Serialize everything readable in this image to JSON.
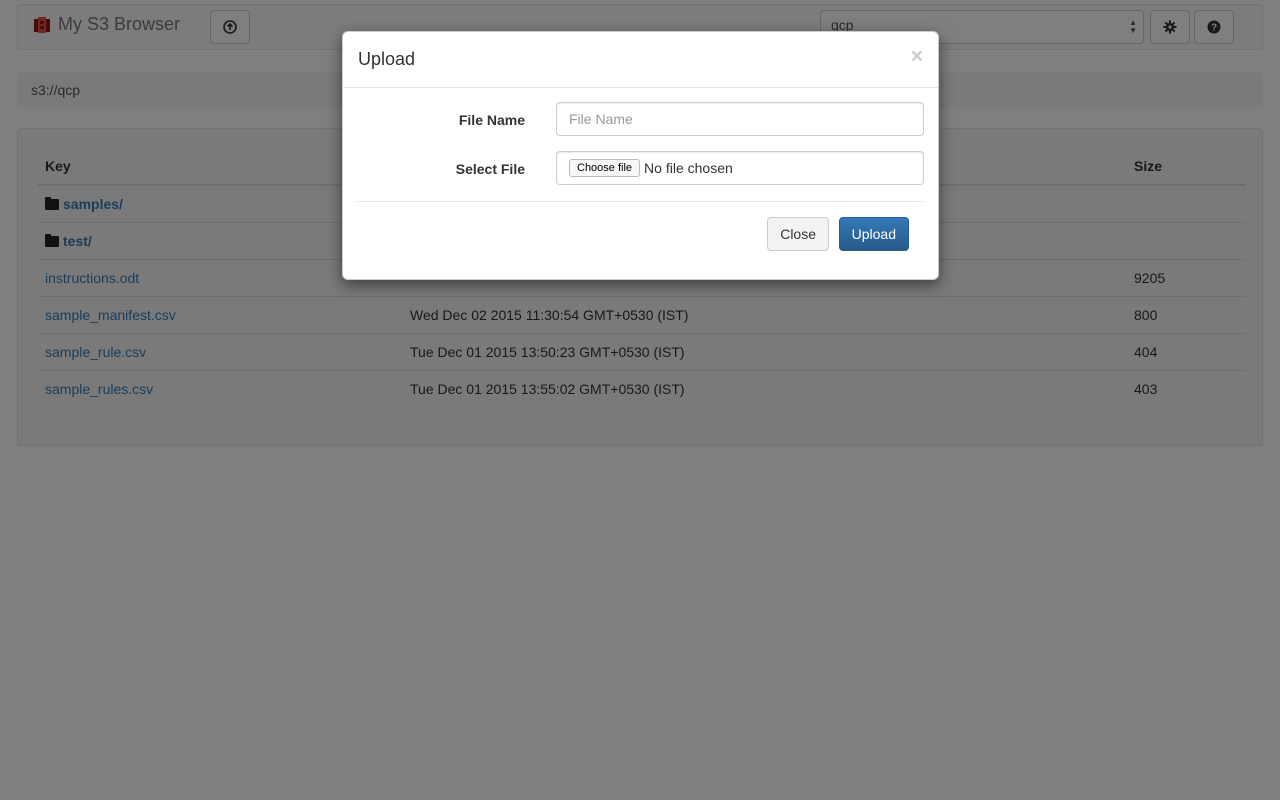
{
  "app": {
    "brand": "My S3 Browser",
    "brand_icon": "s3-logo-icon",
    "upload_icon": "circle-arrow-up-icon",
    "settings_icon": "gear-icon",
    "help_icon": "question-circle-icon",
    "bucket_selected": "qcp"
  },
  "breadcrumb": "s3://qcp",
  "table": {
    "headers": {
      "key": "Key",
      "modified": "",
      "size": "Size"
    },
    "rows": [
      {
        "key": "samples/",
        "type": "folder",
        "modified": "",
        "size": ""
      },
      {
        "key": "test/",
        "type": "folder",
        "modified": "",
        "size": ""
      },
      {
        "key": "instructions.odt",
        "type": "file",
        "modified": "",
        "size": "9205"
      },
      {
        "key": "sample_manifest.csv",
        "type": "file",
        "modified": "Wed Dec 02 2015 11:30:54 GMT+0530 (IST)",
        "size": "800"
      },
      {
        "key": "sample_rule.csv",
        "type": "file",
        "modified": "Tue Dec 01 2015 13:50:23 GMT+0530 (IST)",
        "size": "404"
      },
      {
        "key": "sample_rules.csv",
        "type": "file",
        "modified": "Tue Dec 01 2015 13:55:02 GMT+0530 (IST)",
        "size": "403"
      }
    ]
  },
  "modal": {
    "title": "Upload",
    "close_symbol": "×",
    "file_name_label": "File Name",
    "file_name_placeholder": "File Name",
    "file_name_value": "",
    "select_file_label": "Select File",
    "choose_file_label": "Choose file",
    "no_file_text": "No file chosen",
    "close_button": "Close",
    "upload_button": "Upload"
  },
  "colors": {
    "primary": "#337ab7",
    "link": "#337ab7",
    "backdrop": "rgba(0,0,0,0.5)"
  }
}
